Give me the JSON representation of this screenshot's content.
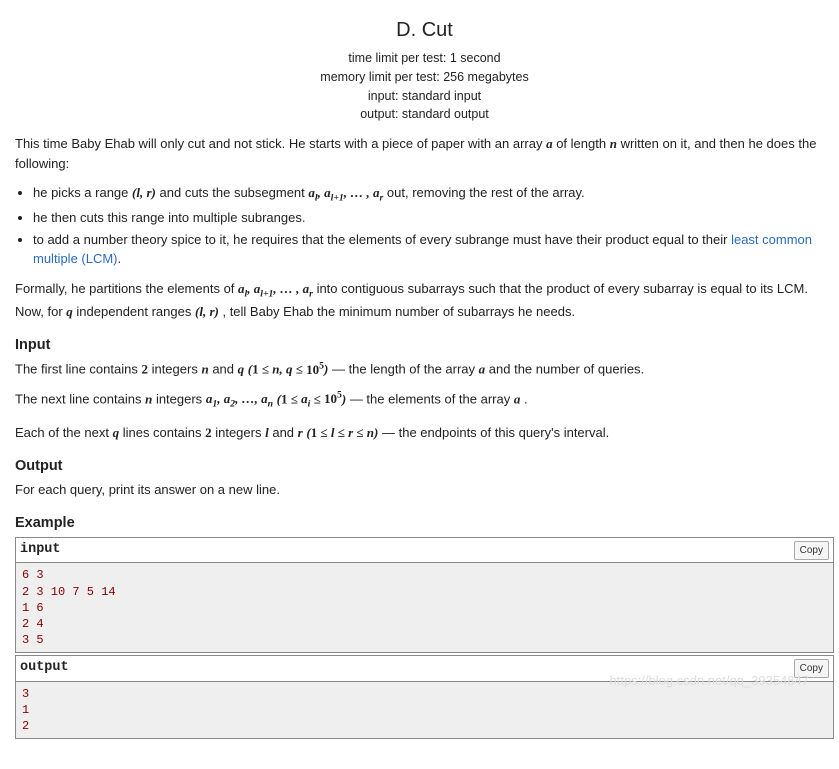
{
  "header": {
    "title": "D. Cut",
    "time_limit": "time limit per test: 1 second",
    "memory_limit": "memory limit per test: 256 megabytes",
    "input": "input: standard input",
    "output": "output: standard output"
  },
  "statement": {
    "p1_a": "This time Baby Ehab will only cut and not stick. He starts with a piece of paper with an array ",
    "p1_b": " of length ",
    "p1_c": " written on it, and then he does the following:",
    "li1_a": "he picks a range ",
    "li1_b": " and cuts the subsegment ",
    "li1_c": " out, removing the rest of the array.",
    "li2": "he then cuts this range into multiple subranges.",
    "li3_a": "to add a number theory spice to it, he requires that the elements of every subrange must have their product equal to their ",
    "li3_link": "least common multiple (LCM)",
    "li3_b": ".",
    "p2_a": "Formally, he partitions the elements of ",
    "p2_b": " into contiguous subarrays such that the product of every subarray is equal to its LCM. Now, for ",
    "p2_c": " independent ranges ",
    "p2_d": ", tell Baby Ehab the minimum number of subarrays he needs."
  },
  "input_section": {
    "heading": "Input",
    "l1_a": "The first line contains ",
    "l1_b": " integers ",
    "l1_c": " and ",
    "l1_d": " — the length of the array ",
    "l1_e": " and the number of queries.",
    "l2_a": "The next line contains ",
    "l2_b": " integers ",
    "l2_c": " — the elements of the array ",
    "l2_d": ".",
    "l3_a": "Each of the next ",
    "l3_b": " lines contains ",
    "l3_c": " integers ",
    "l3_d": " and ",
    "l3_e": " — the endpoints of this query's interval."
  },
  "output_section": {
    "heading": "Output",
    "text": "For each query, print its answer on a new line."
  },
  "example": {
    "heading": "Example",
    "input_label": "input",
    "output_label": "output",
    "copy_label": "Copy",
    "input_data": "6 3\n2 3 10 7 5 14\n1 6\n2 4\n3 5",
    "output_data": "3\n1\n2"
  },
  "math": {
    "a": "a",
    "n": "n",
    "q": "q",
    "l": "l",
    "r": "r",
    "two": "2",
    "lr": "(l, r)",
    "seq": "aₗ, aₗ₊₁, … , aᵣ",
    "range_nq": "(1 ≤ n, q ≤ 10⁵)",
    "arr": "a₁, a₂, …, aₙ",
    "range_ai": "(1 ≤ aᵢ ≤ 10⁵)",
    "range_lr": "(1 ≤ l ≤ r ≤ n)"
  },
  "watermark": "https://blog.csdn.net/qq_39354847"
}
